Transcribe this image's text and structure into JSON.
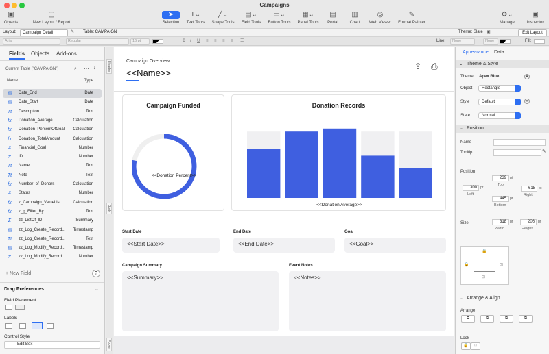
{
  "window": {
    "title": "Campaigns"
  },
  "toolbar": {
    "items": [
      {
        "label": "Objects",
        "icon": "sidebar-icon"
      },
      {
        "label": "New Layout / Report",
        "icon": "new-layout-icon"
      },
      {
        "label": "Selection",
        "icon": "arrow-pointer-icon"
      },
      {
        "label": "Text Tools",
        "icon": "text-tool-icon"
      },
      {
        "label": "Shape Tools",
        "icon": "line-tool-icon"
      },
      {
        "label": "Field Tools",
        "icon": "field-tool-icon"
      },
      {
        "label": "Button Tools",
        "icon": "button-tool-icon"
      },
      {
        "label": "Panel Tools",
        "icon": "panel-tool-icon"
      },
      {
        "label": "Portal",
        "icon": "portal-icon"
      },
      {
        "label": "Chart",
        "icon": "chart-icon"
      },
      {
        "label": "Web Viewer",
        "icon": "globe-icon"
      },
      {
        "label": "Format Painter",
        "icon": "brush-icon"
      },
      {
        "label": "Manage",
        "icon": "gear-icon"
      },
      {
        "label": "Inspector",
        "icon": "inspector-icon"
      }
    ]
  },
  "layoutbar": {
    "layout_label": "Layout:",
    "layout_value": "Campaign Detail",
    "table_label": "Table: CAMPAIGN",
    "theme": "Theme: Slate",
    "exit": "Exit Layout"
  },
  "formatbar": {
    "font": "Arial",
    "style": "Regular",
    "size": "16 pt",
    "line_label": "Line:",
    "line_value": "None",
    "fill_label": "Fill:",
    "none1": "None",
    "none2": "None"
  },
  "left": {
    "tabs": [
      "Fields",
      "Objects",
      "Add-ons"
    ],
    "table_select": "Current Table (\"CAMPAIGN\")",
    "col_name": "Name",
    "col_type": "Type",
    "fields": [
      {
        "icon": "▤",
        "name": "Date_End",
        "type": "Date",
        "sel": true
      },
      {
        "icon": "▤",
        "name": "Date_Start",
        "type": "Date"
      },
      {
        "icon": "Tt",
        "name": "Description",
        "type": "Text"
      },
      {
        "icon": "fx",
        "name": "Donation_Average",
        "type": "Calculation"
      },
      {
        "icon": "fx",
        "name": "Donation_PercentOfGoal",
        "type": "Calculation"
      },
      {
        "icon": "fx",
        "name": "Donation_TotalAmount",
        "type": "Calculation"
      },
      {
        "icon": "#",
        "name": "Financial_Goal",
        "type": "Number"
      },
      {
        "icon": "#",
        "name": "ID",
        "type": "Number"
      },
      {
        "icon": "Tt",
        "name": "Name",
        "type": "Text"
      },
      {
        "icon": "Tt",
        "name": "Note",
        "type": "Text"
      },
      {
        "icon": "fx",
        "name": "Number_of_Donors",
        "type": "Calculation"
      },
      {
        "icon": "#",
        "name": "Status",
        "type": "Number"
      },
      {
        "icon": "fx",
        "name": "z_Campaign_ValueList",
        "type": "Calculation"
      },
      {
        "icon": "fx",
        "name": "z_g_Filter_By",
        "type": "Text"
      },
      {
        "icon": "Σ",
        "name": "zz_ListOf_ID",
        "type": "Summary"
      },
      {
        "icon": "▤",
        "name": "zz_Log_Create_Record...",
        "type": "Timestamp"
      },
      {
        "icon": "Tt",
        "name": "zz_Log_Create_Record...",
        "type": "Text"
      },
      {
        "icon": "▤",
        "name": "zz_Log_Modify_Record...",
        "type": "Timestamp"
      },
      {
        "icon": "#",
        "name": "zz_Log_Modify_Record...",
        "type": "Number"
      }
    ],
    "new_field": "+ New Field",
    "help": "?",
    "drag_prefs": "Drag Preferences",
    "field_placement": "Field Placement",
    "labels": "Labels",
    "control_style": "Control Style",
    "control_value": "Edit Box"
  },
  "canvas": {
    "parts": {
      "header": "Header",
      "body": "Body",
      "footer": "Footer"
    },
    "overview": "Campaign Overview",
    "name_field": "<<Name>>",
    "funded_title": "Campaign Funded",
    "donation_percent": "<<Donation Percent>>",
    "donation_percent_value": 0.78,
    "records_title": "Donation Records",
    "donation_average": "<<Donation Average>>",
    "start_label": "Start Date",
    "start_field": "<<Start Date>>",
    "end_label": "End Date",
    "end_field": "<<End Date>>",
    "goal_label": "Goal",
    "goal_field": "<<Goal>>",
    "summary_label": "Campaign Summary",
    "summary_field": "<<Summary>>",
    "notes_label": "Event Notes",
    "notes_field": "<<Notes>>"
  },
  "chart_data": {
    "type": "bar",
    "title": "Donation Records",
    "xlabel": "<<Donation Average>>",
    "ylabel": "",
    "values": [
      0.65,
      0.88,
      0.92,
      0.56,
      0.4
    ],
    "background": [
      0.88,
      0.88,
      0.92,
      0.88,
      0.88
    ],
    "ylim": [
      0,
      1
    ],
    "color": "#3f5fe0"
  },
  "right": {
    "tabs": [
      "Appearance",
      "Data"
    ],
    "theme_style": "Theme & Style",
    "theme_label": "Theme",
    "theme_value": "Apex Blue",
    "object_label": "Object",
    "object_value": "Rectangle",
    "style_label": "Style",
    "style_value": "Default",
    "state_label": "State",
    "state_value": "Normal",
    "position": "Position",
    "name_label": "Name",
    "tooltip_label": "Tooltip",
    "position_label": "Position",
    "top": "239",
    "left": "300",
    "right": "618",
    "bottom": "445",
    "unit": "pt",
    "top_l": "Top",
    "left_l": "Left",
    "right_l": "Right",
    "bottom_l": "Bottom",
    "size_label": "Size",
    "width": "318",
    "height": "206",
    "width_l": "Width",
    "height_l": "Height",
    "arrange_align": "Arrange & Align",
    "arrange": "Arrange",
    "lock": "Lock"
  },
  "colors": {
    "accent": "#2e6ff2",
    "bar": "#3f5fe0",
    "ring": "#3f5fe0"
  }
}
